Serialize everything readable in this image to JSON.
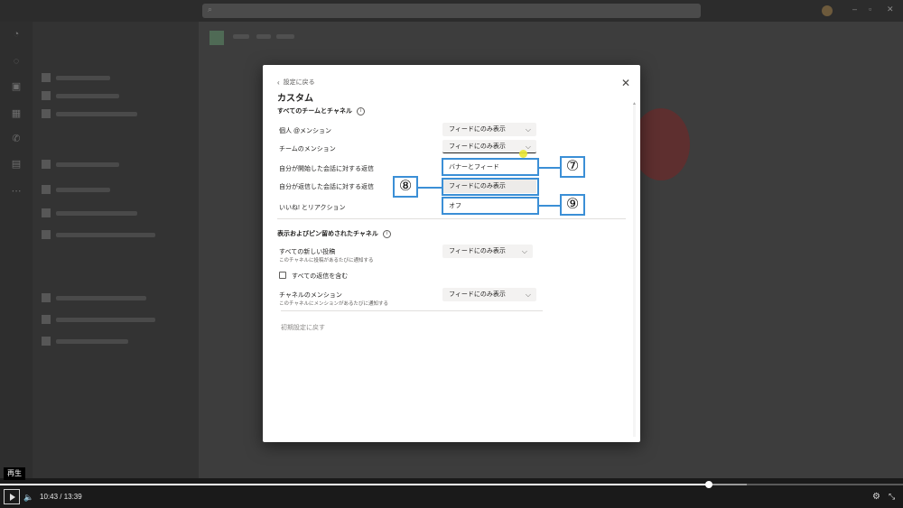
{
  "dialog": {
    "back_label": "設定に戻る",
    "title": "カスタム",
    "section1_title": "すべてのチームとチャネル",
    "section1_rows": [
      {
        "label": "個人 @メンション",
        "value": "フィードにのみ表示"
      },
      {
        "label": "チームのメンション",
        "value": "フィードにのみ表示"
      },
      {
        "label": "自分が開始した会話に対する返信",
        "value": "バナーとフィード"
      },
      {
        "label": "自分が返信した会話に対する返信",
        "value": "フィードにのみ表示"
      },
      {
        "label": "いいね! とリアクション",
        "value": "オフ"
      }
    ],
    "section2_title": "表示およびピン留めされたチャネル",
    "all_posts_label": "すべての新しい投稿",
    "all_posts_sub": "このチャネルに投稿があるたびに通知する",
    "all_posts_value": "フィードにのみ表示",
    "include_replies_label": "すべての返信を含む",
    "channel_mention_label": "チャネルのメンション",
    "channel_mention_sub": "このチャネルにメンションがあるたびに通知する",
    "channel_mention_value": "フィードにのみ表示",
    "reset_label": "初期設定に戻す"
  },
  "callouts": {
    "c7": "⑦",
    "c8": "⑧",
    "c9": "⑨"
  },
  "player": {
    "tooltip": "再生",
    "time": "10:43 / 13:39",
    "progress_fraction": 0.785
  },
  "colors": {
    "callout_blue": "#3b8fd6",
    "cursor_yellow": "#e9e632"
  }
}
